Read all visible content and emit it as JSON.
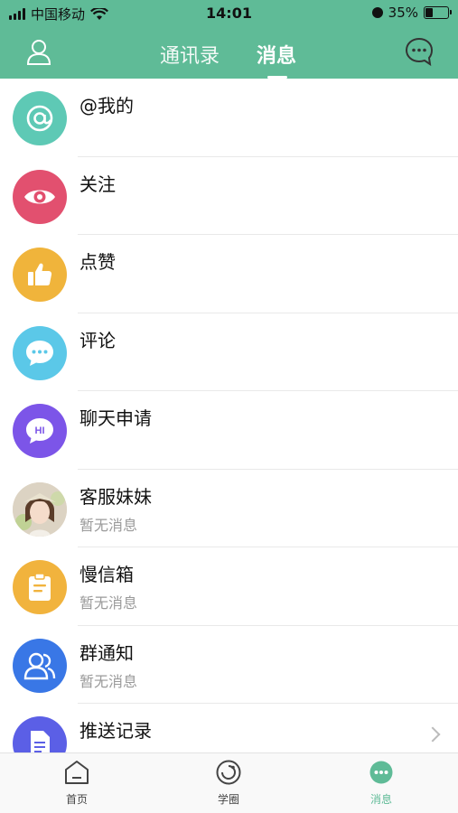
{
  "status_bar": {
    "carrier": "中国移动",
    "time": "14:01",
    "battery": "35%",
    "battery_level": 0.35
  },
  "header": {
    "tabs": [
      {
        "label": "通讯录",
        "active": false
      },
      {
        "label": "消息",
        "active": true
      }
    ],
    "icons": {
      "left": "contacts-person-icon",
      "right": "chat-bubble-icon"
    }
  },
  "messages": [
    {
      "title": "@我的",
      "subtitle": "",
      "icon": "at-icon",
      "color": "#5ec9b5"
    },
    {
      "title": "关注",
      "subtitle": "",
      "icon": "eye-icon",
      "color": "#e2506f"
    },
    {
      "title": "点赞",
      "subtitle": "",
      "icon": "thumbs-up-icon",
      "color": "#f0b43b"
    },
    {
      "title": "评论",
      "subtitle": "",
      "icon": "comment-icon",
      "color": "#5bc8e8"
    },
    {
      "title": "聊天申请",
      "subtitle": "",
      "icon": "hi-chat-icon",
      "color": "#7c55e8"
    },
    {
      "title": "客服妹妹",
      "subtitle": "暂无消息",
      "icon": "customer-service-avatar",
      "color": "#e8d8c5"
    },
    {
      "title": "慢信箱",
      "subtitle": "暂无消息",
      "icon": "clipboard-icon",
      "color": "#f1b33d"
    },
    {
      "title": "群通知",
      "subtitle": "暂无消息",
      "icon": "group-icon",
      "color": "#3977e6"
    },
    {
      "title": "推送记录",
      "subtitle": "",
      "icon": "document-icon",
      "color": "#5b5fe6"
    }
  ],
  "bottom_nav": [
    {
      "label": "首页",
      "icon": "home-icon",
      "active": false
    },
    {
      "label": "学圈",
      "icon": "circle-icon",
      "active": false
    },
    {
      "label": "消息",
      "icon": "message-icon",
      "active": true
    }
  ]
}
